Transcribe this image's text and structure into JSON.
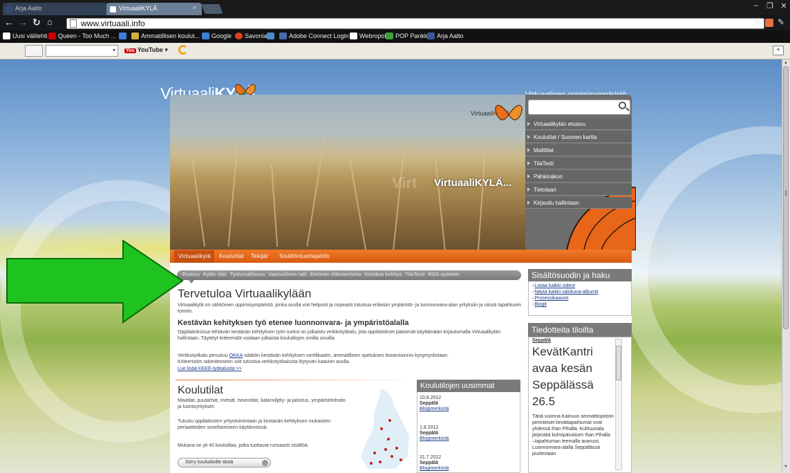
{
  "browser": {
    "tabs": [
      {
        "label": "Arja Aalto",
        "icon": "facebook-icon"
      },
      {
        "label": "VirtuaaliKYLÄ",
        "icon": "page-icon"
      }
    ],
    "url": "www.virtuaali.info",
    "window_controls": [
      "–",
      "❐",
      "✕"
    ],
    "bookmarks": [
      {
        "label": "Uusi välilehti",
        "icon": "page-icon",
        "color": "#ffffff"
      },
      {
        "label": "Queen - Too Much ...",
        "icon": "youtube-icon",
        "color": "#cc0000"
      },
      {
        "label": "",
        "icon": "google-icon",
        "color": "#3c7edb"
      },
      {
        "label": "Ammatillisen koulut...",
        "icon": "pen-icon",
        "color": "#d0b040"
      },
      {
        "label": "Google",
        "icon": "google-icon",
        "color": "#3c7edb"
      },
      {
        "label": "Savonia",
        "icon": "savonia-icon",
        "color": "#e04020"
      },
      {
        "label": "",
        "icon": "search-icon",
        "color": "#4a8ad0"
      },
      {
        "label": "Adobe Connect Login",
        "icon": "adobe-icon",
        "color": "#4a6ab0"
      },
      {
        "label": "Webropol",
        "icon": "page-icon",
        "color": "#ffffff"
      },
      {
        "label": "POP Pankki",
        "icon": "pop-icon",
        "color": "#40a040"
      },
      {
        "label": "Arja Aalto",
        "icon": "facebook-icon",
        "color": "#3b5998"
      }
    ],
    "google_toolbar": {
      "youtube_label": "YouTube"
    }
  },
  "site": {
    "logo_plain": "Virtuaali",
    "logo_bold": "KYLÄ",
    "tagline": "Virtuaalinen oppimisympäristö",
    "hero_logo_plain": "Virtuaali",
    "hero_logo_bold": "KYLÄ",
    "hero_big": "VirtuaaliKYLÄ...",
    "hero_ghost": "Virt",
    "right_nav": [
      "Virtuaalikylän etusivu",
      "Koulutilat / Suomen kartta",
      "Mallitilat",
      "TilaTesti",
      "Pähkinäkori",
      "Tietolaari",
      "Kirjaudu hallintaan"
    ],
    "main_tabs": [
      "Virtuaalikylä",
      "Koulutilat",
      "Tekijät",
      "Sisällöntuottajainfo"
    ],
    "sub_nav": [
      "Etusivu",
      "Kylän tilat",
      "Työturvallisuus",
      "Vastuullinen talli",
      "Eettinen eläintenhoito",
      "Kestävä kehitys",
      "TilaTesti",
      "RSS-syötteet"
    ],
    "welcome_title": "Tervetuloa Virtuaalikylään",
    "welcome_text": "Virtuaalikylä on sähköinen oppimisympäristö, jonka avulla voit helposti ja nopeasti tutustua erilaisiin ympäristö- ja luonnonvara-alan yrityksiin ja niissä tapahtuviin toimiin.",
    "kk_title": "Kestävän kehityksen työ etenee luonnonvara- ja ympäristöalalla",
    "kk_text1": "Oppilaitoksissa tehtävän kestävän kehityksen työn tueksi on julkaistu verkkotyökalu, jota oppilaitokset pääsevät käyttämään kirjautumalla Virtuaalikylän hallintaan. Täytetyt kriteeristöt voidaan julkaista koulutilojen omilla sivuilla.",
    "kk_text2a": "Verkkotyökalu perustuu ",
    "kk_text2_link": "OKKA",
    "kk_text2b": "-säätiön kestävän kehityksen sertifikaatin, ammatillisen opetuksen itsearvioinnin kysymyslistaan.",
    "kk_text3": "Kriteeristön rakenteeseen voit tutustua verkkotyökalusta löytyvän kaavion avulla.",
    "kk_link": "Lue lisää KEKE-työkalusta >>",
    "koulutilat_title": "Koulutilat",
    "koulutilat_text1": "Maatilat, puutarhat, metsät, hevostilat, kalanviljely- ja jalostus, ympäristönhoito ja luontoyritykset.",
    "koulutilat_text2": "Tutustu oppilaitosten yritystoimintaan ja kestävän kehityksen mukaisten periaatteiden soveltamiseen käytännössä.",
    "koulutilat_text3": "Mukana on yli 40 koulutilaa, jotka tuottavat runsaasti sisältöä.",
    "koulutilat_button": "Siirry koulutiloille tästä",
    "latest_title": "Koulutilojen uusimmat",
    "latest": [
      {
        "date": "10.8.2012",
        "place": "Seppälä",
        "link": "Blogimerkintä"
      },
      {
        "date": "1.8.2012",
        "place": "Seppälä",
        "link": "Blogimerkintä"
      },
      {
        "date": "31.7.2012",
        "place": "Seppälä",
        "link": "Blogimerkintä"
      }
    ],
    "filter_title": "Sisältösuodin ja haku",
    "filter_links": [
      "Listaa kaikki videot",
      "Näytä kaikki valokuva-albumit",
      "Prosessikaaviot",
      "Blogit"
    ],
    "news_title": "Tiedotteita tiloilta",
    "news_source": "Seppälä",
    "news_headline": "KevätKantri avaa kesän Seppälässä 26.5",
    "news_body": "Tänä vuonna Kainuun ammattiopiston perinteiset kevättapahtumat ovat yhdessä Ihan Pihalla. Kulttuuriala järjestää kolmipäiväisen Ihan Pihalla –tapahtuman teemalla avaruus. Luonnonvara-alalla Seppälässä puolestaan"
  },
  "colors": {
    "accent_orange": "#e8661a",
    "arrow_green": "#1fc31f",
    "nav_gray": "#6d6d6d"
  }
}
